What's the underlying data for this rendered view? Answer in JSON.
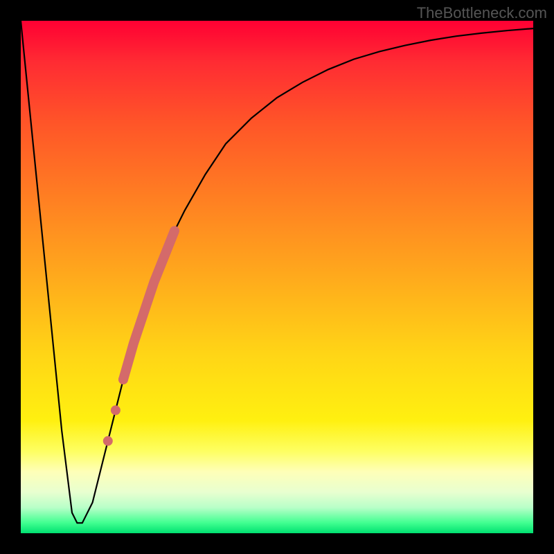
{
  "watermark": "TheBottleneck.com",
  "chart_data": {
    "type": "line",
    "title": "",
    "xlabel": "",
    "ylabel": "",
    "xlim": [
      0,
      100
    ],
    "ylim": [
      0,
      100
    ],
    "grid": false,
    "legend": false,
    "series": [
      {
        "name": "bottleneck-curve",
        "color": "#000000",
        "x": [
          0,
          2,
          4,
          6,
          8,
          10,
          11,
          12,
          14,
          16,
          18,
          20,
          22,
          24,
          26,
          28,
          30,
          32,
          36,
          40,
          45,
          50,
          55,
          60,
          65,
          70,
          75,
          80,
          85,
          90,
          95,
          100
        ],
        "y": [
          100,
          80,
          60,
          40,
          20,
          4,
          2,
          2,
          6,
          14,
          22,
          30,
          37,
          43,
          49,
          54,
          59,
          63,
          70,
          76,
          81,
          85,
          88,
          90.5,
          92.5,
          94,
          95.2,
          96.2,
          97,
          97.6,
          98.1,
          98.5
        ]
      },
      {
        "name": "highlight-segment",
        "color": "#d46a6a",
        "style": "thick",
        "x": [
          20,
          22,
          24,
          26,
          28,
          30
        ],
        "y": [
          30,
          37,
          43,
          49,
          54,
          59
        ]
      },
      {
        "name": "highlight-dots",
        "color": "#d46a6a",
        "style": "dots",
        "x": [
          17,
          18.5,
          20
        ],
        "y": [
          18,
          24,
          30
        ]
      }
    ],
    "gradient_stops": [
      {
        "pos": 0,
        "color": "#ff0033"
      },
      {
        "pos": 50,
        "color": "#ffaa1c"
      },
      {
        "pos": 80,
        "color": "#fff010"
      },
      {
        "pos": 100,
        "color": "#00e070"
      }
    ]
  }
}
